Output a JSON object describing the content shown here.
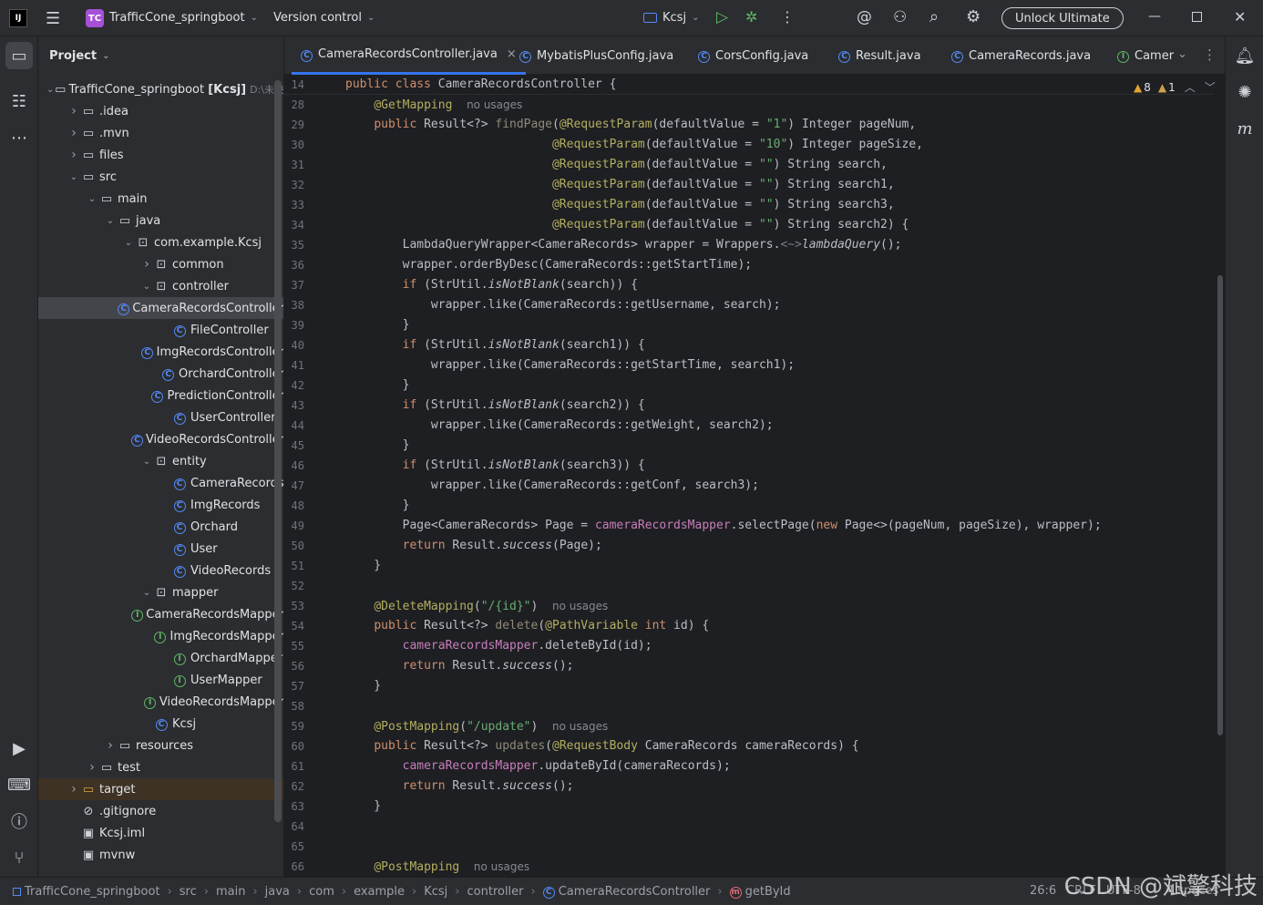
{
  "titlebar": {
    "app_logo": "IJ",
    "project_badge": "TC",
    "project_name": "TrafficCone_springboot",
    "vcs": "Version control",
    "run_config": "Kcsj",
    "unlock": "Unlock Ultimate"
  },
  "project_panel": {
    "title": "Project",
    "root_label": "TrafficCone_springboot [Kcsj]",
    "root_path": "D:\\未央"
  },
  "tree": [
    {
      "depth": 0,
      "chev": "v",
      "icon": "folder",
      "label": "TrafficCone_springboot [Kcsj]",
      "path": "D:\\未央"
    },
    {
      "depth": 1,
      "chev": ">",
      "icon": "folder",
      "label": ".idea"
    },
    {
      "depth": 1,
      "chev": ">",
      "icon": "folder",
      "label": ".mvn"
    },
    {
      "depth": 1,
      "chev": ">",
      "icon": "folder",
      "label": "files"
    },
    {
      "depth": 1,
      "chev": "v",
      "icon": "folder",
      "label": "src"
    },
    {
      "depth": 2,
      "chev": "v",
      "icon": "folder",
      "label": "main"
    },
    {
      "depth": 3,
      "chev": "v",
      "icon": "folder",
      "label": "java"
    },
    {
      "depth": 4,
      "chev": "v",
      "icon": "package",
      "label": "com.example.Kcsj"
    },
    {
      "depth": 5,
      "chev": ">",
      "icon": "package",
      "label": "common"
    },
    {
      "depth": 5,
      "chev": "v",
      "icon": "package",
      "label": "controller"
    },
    {
      "depth": 6,
      "chev": "",
      "icon": "class",
      "label": "CameraRecordsController",
      "sel": true
    },
    {
      "depth": 6,
      "chev": "",
      "icon": "class",
      "label": "FileController"
    },
    {
      "depth": 6,
      "chev": "",
      "icon": "class",
      "label": "ImgRecordsController"
    },
    {
      "depth": 6,
      "chev": "",
      "icon": "class",
      "label": "OrchardController"
    },
    {
      "depth": 6,
      "chev": "",
      "icon": "class",
      "label": "PredictionController"
    },
    {
      "depth": 6,
      "chev": "",
      "icon": "class",
      "label": "UserController"
    },
    {
      "depth": 6,
      "chev": "",
      "icon": "class",
      "label": "VideoRecordsController"
    },
    {
      "depth": 5,
      "chev": "v",
      "icon": "package",
      "label": "entity"
    },
    {
      "depth": 6,
      "chev": "",
      "icon": "class",
      "label": "CameraRecords"
    },
    {
      "depth": 6,
      "chev": "",
      "icon": "class",
      "label": "ImgRecords"
    },
    {
      "depth": 6,
      "chev": "",
      "icon": "class",
      "label": "Orchard"
    },
    {
      "depth": 6,
      "chev": "",
      "icon": "class",
      "label": "User"
    },
    {
      "depth": 6,
      "chev": "",
      "icon": "class",
      "label": "VideoRecords"
    },
    {
      "depth": 5,
      "chev": "v",
      "icon": "package",
      "label": "mapper"
    },
    {
      "depth": 6,
      "chev": "",
      "icon": "interface",
      "label": "CameraRecordsMapper"
    },
    {
      "depth": 6,
      "chev": "",
      "icon": "interface",
      "label": "ImgRecordsMapper"
    },
    {
      "depth": 6,
      "chev": "",
      "icon": "interface",
      "label": "OrchardMapper"
    },
    {
      "depth": 6,
      "chev": "",
      "icon": "interface",
      "label": "UserMapper"
    },
    {
      "depth": 6,
      "chev": "",
      "icon": "interface",
      "label": "VideoRecordsMapper"
    },
    {
      "depth": 5,
      "chev": "",
      "icon": "springclass",
      "label": "Kcsj"
    },
    {
      "depth": 3,
      "chev": ">",
      "icon": "folder",
      "label": "resources"
    },
    {
      "depth": 2,
      "chev": ">",
      "icon": "folder",
      "label": "test"
    },
    {
      "depth": 1,
      "chev": ">",
      "icon": "folder-orange",
      "label": "target",
      "hl": true
    },
    {
      "depth": 1,
      "chev": "",
      "icon": "ignore",
      "label": ".gitignore"
    },
    {
      "depth": 1,
      "chev": "",
      "icon": "file",
      "label": "Kcsj.iml"
    },
    {
      "depth": 1,
      "chev": "",
      "icon": "file",
      "label": "mvnw"
    }
  ],
  "tabs": [
    {
      "label": "CameraRecordsController.java",
      "active": true
    },
    {
      "label": "MybatisPlusConfig.java"
    },
    {
      "label": "CorsConfig.java"
    },
    {
      "label": "Result.java"
    },
    {
      "label": "CameraRecords.java"
    },
    {
      "label": "Camer",
      "icon": "interface"
    }
  ],
  "editor": {
    "warnings": "8",
    "weak_warnings": "1",
    "sticky_line": "14",
    "sticky_code": "public class CameraRecordsController {"
  },
  "code_lines": [
    {
      "n": "28",
      "html": "    <span class='an'>@GetMapping</span>  <span class='hint'>no usages</span>"
    },
    {
      "n": "29",
      "html": "    <span class='kw'>public</span> Result&lt;?&gt; <span class='dimcls'>findPage</span>(<span class='an'>@RequestParam</span>(defaultValue = <span class='str'>\"1\"</span>) Integer pageNum,"
    },
    {
      "n": "30",
      "html": "                             <span class='an'>@RequestParam</span>(defaultValue = <span class='str'>\"10\"</span>) Integer pageSize,"
    },
    {
      "n": "31",
      "html": "                             <span class='an'>@RequestParam</span>(defaultValue = <span class='str'>\"\"</span>) String search,"
    },
    {
      "n": "32",
      "html": "                             <span class='an'>@RequestParam</span>(defaultValue = <span class='str'>\"\"</span>) String search1,"
    },
    {
      "n": "33",
      "html": "                             <span class='an'>@RequestParam</span>(defaultValue = <span class='str'>\"\"</span>) String search3,"
    },
    {
      "n": "34",
      "html": "                             <span class='an'>@RequestParam</span>(defaultValue = <span class='str'>\"\"</span>) String search2) {"
    },
    {
      "n": "35",
      "html": "        LambdaQueryWrapper&lt;CameraRecords&gt; wrapper = Wrappers.<span class='gray'>&lt;~&gt;</span><span class='it'>lambdaQuery</span>();"
    },
    {
      "n": "36",
      "html": "        wrapper.orderByDesc(CameraRecords::getStartTime);"
    },
    {
      "n": "37",
      "html": "        <span class='kw'>if</span> (StrUtil.<span class='it'>isNotBlank</span>(search)) {"
    },
    {
      "n": "38",
      "html": "            wrapper.like(CameraRecords::getUsername, search);"
    },
    {
      "n": "39",
      "html": "        }"
    },
    {
      "n": "40",
      "html": "        <span class='kw'>if</span> (StrUtil.<span class='it'>isNotBlank</span>(search1)) {"
    },
    {
      "n": "41",
      "html": "            wrapper.like(CameraRecords::getStartTime, search1);"
    },
    {
      "n": "42",
      "html": "        }"
    },
    {
      "n": "43",
      "html": "        <span class='kw'>if</span> (StrUtil.<span class='it'>isNotBlank</span>(search2)) {"
    },
    {
      "n": "44",
      "html": "            wrapper.like(CameraRecords::getWeight, search2);"
    },
    {
      "n": "45",
      "html": "        }"
    },
    {
      "n": "46",
      "html": "        <span class='kw'>if</span> (StrUtil.<span class='it'>isNotBlank</span>(search3)) {"
    },
    {
      "n": "47",
      "html": "            wrapper.like(CameraRecords::getConf, search3);"
    },
    {
      "n": "48",
      "html": "        }"
    },
    {
      "n": "49",
      "html": "        Page&lt;CameraRecords&gt; Page = <span class='fld'>cameraRecordsMapper</span>.selectPage(<span class='kw'>new</span> Page&lt;&gt;(pageNum, pageSize), wrapper);"
    },
    {
      "n": "50",
      "html": "        <span class='kw'>return</span> Result.<span class='it'>success</span>(Page);"
    },
    {
      "n": "51",
      "html": "    }"
    },
    {
      "n": "52",
      "html": ""
    },
    {
      "n": "53",
      "html": "    <span class='an'>@DeleteMapping</span>(<span class='str'>\"/{id}\"</span>)  <span class='hint'>no usages</span>"
    },
    {
      "n": "54",
      "html": "    <span class='kw'>public</span> Result&lt;?&gt; <span class='dimcls'>delete</span>(<span class='an'>@PathVariable</span> <span class='kw'>int</span> id) {"
    },
    {
      "n": "55",
      "html": "        <span class='fld'>cameraRecordsMapper</span>.deleteById(id);"
    },
    {
      "n": "56",
      "html": "        <span class='kw'>return</span> Result.<span class='it'>success</span>();"
    },
    {
      "n": "57",
      "html": "    }"
    },
    {
      "n": "58",
      "html": ""
    },
    {
      "n": "59",
      "html": "    <span class='an'>@PostMapping</span>(<span class='str'>\"/update\"</span>)  <span class='hint'>no usages</span>"
    },
    {
      "n": "60",
      "html": "    <span class='kw'>public</span> Result&lt;?&gt; <span class='dimcls'>updates</span>(<span class='an'>@RequestBody</span> CameraRecords cameraRecords) {"
    },
    {
      "n": "61",
      "html": "        <span class='fld'>cameraRecordsMapper</span>.updateById(cameraRecords);"
    },
    {
      "n": "62",
      "html": "        <span class='kw'>return</span> Result.<span class='it'>success</span>();"
    },
    {
      "n": "63",
      "html": "    }"
    },
    {
      "n": "64",
      "html": ""
    },
    {
      "n": "65",
      "html": ""
    },
    {
      "n": "66",
      "html": "    <span class='an'>@PostMapping</span>  <span class='hint'>no usages</span>"
    }
  ],
  "breadcrumbs": [
    "TrafficCone_springboot",
    "src",
    "main",
    "java",
    "com",
    "example",
    "Kcsj",
    "controller",
    "CameraRecordsController",
    "getById"
  ],
  "status": {
    "position": "26:6",
    "encoding": "UTF-8",
    "lf": "CRLF",
    "indent": "4 spaces"
  },
  "watermark": "CSDN @斌擎科技"
}
